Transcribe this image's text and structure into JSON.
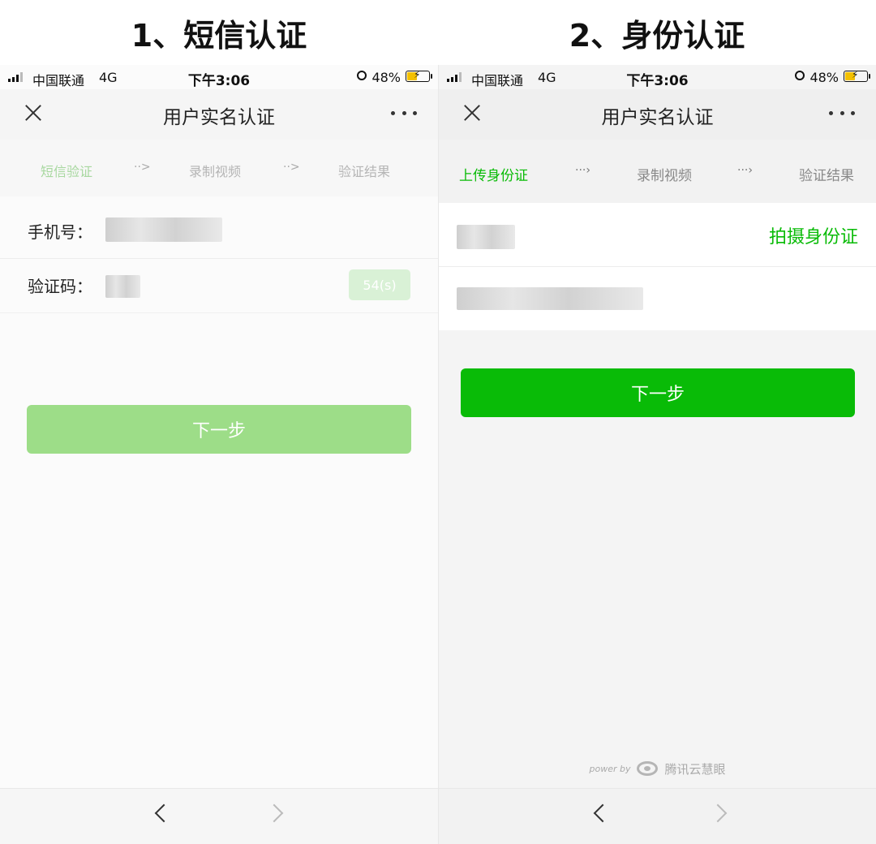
{
  "panels": {
    "left": {
      "heading": "1、短信认证"
    },
    "right": {
      "heading": "2、身份认证"
    }
  },
  "status_bar": {
    "carrier": "中国联通",
    "network": "4G",
    "time": "下午3:06",
    "battery": "48%"
  },
  "navbar": {
    "title": "用户实名认证"
  },
  "left": {
    "steps": {
      "step1": "短信验证",
      "arrow": "··>",
      "step2": "录制视频",
      "step3": "验证结果"
    },
    "phone_label": "手机号：",
    "code_label": "验证码：",
    "countdown": "54(s)",
    "next_button": "下一步"
  },
  "right": {
    "steps": {
      "step1": "上传身份证",
      "arrow": "···›",
      "step2": "录制视频",
      "step3": "验证结果"
    },
    "capture_link": "拍摄身份证",
    "next_button": "下一步",
    "powered_by": "power by",
    "brand": "腾讯云慧眼"
  },
  "colors": {
    "green": "#09bb07",
    "light_green": "#9ddd88",
    "step_active_light": "#a8d8a0"
  }
}
